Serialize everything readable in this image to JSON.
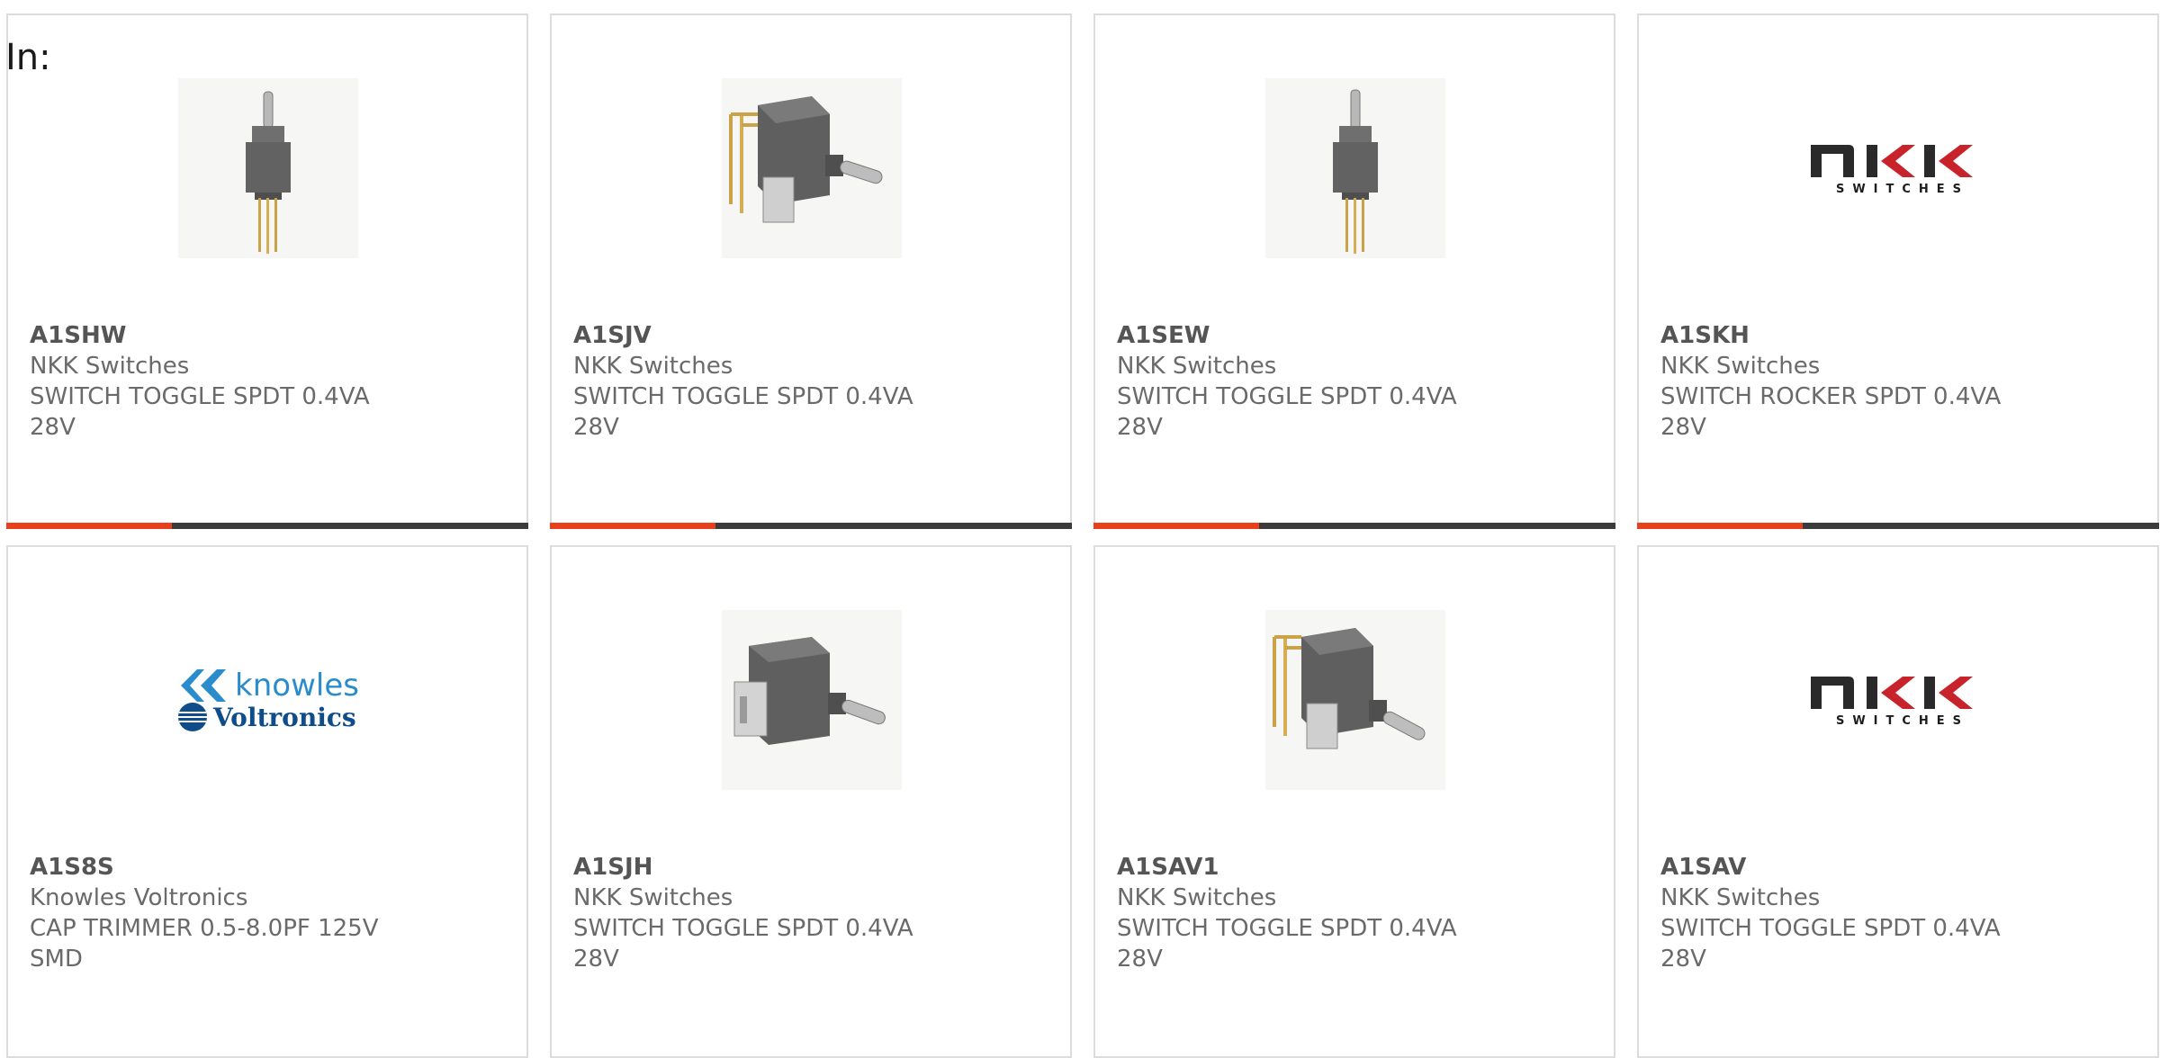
{
  "filter": {
    "in_label": "In:"
  },
  "colors": {
    "accent": "#e8401c",
    "bar_dark": "#3b3b3b",
    "text": "#6a6a6a",
    "border": "#dcdcdc"
  },
  "cards": [
    {
      "part": "A1SHW",
      "maker": "NKK Switches",
      "desc": "SWITCH TOGGLE SPDT 0.4VA",
      "desc2": "28V",
      "image": "toggle-switch-vertical-pins"
    },
    {
      "part": "A1SJV",
      "maker": "NKK Switches",
      "desc": "SWITCH TOGGLE SPDT 0.4VA",
      "desc2": "28V",
      "image": "toggle-switch-right-angle"
    },
    {
      "part": "A1SEW",
      "maker": "NKK Switches",
      "desc": "SWITCH TOGGLE SPDT 0.4VA",
      "desc2": "28V",
      "image": "toggle-switch-vertical-pins"
    },
    {
      "part": "A1SKH",
      "maker": "NKK Switches",
      "desc": "SWITCH ROCKER SPDT 0.4VA",
      "desc2": "28V",
      "image": "nkk-logo",
      "logo_main": "NKK",
      "logo_sub": "SWITCHES"
    },
    {
      "part": "A1S8S",
      "maker": "Knowles Voltronics",
      "desc": "CAP TRIMMER 0.5-8.0PF 125V",
      "desc2": "SMD",
      "image": "knowles-voltronics-logo",
      "logo_main": "knowles",
      "logo_sub": "Voltronics"
    },
    {
      "part": "A1SJH",
      "maker": "NKK Switches",
      "desc": "SWITCH TOGGLE SPDT 0.4VA",
      "desc2": "28V",
      "image": "toggle-switch-horizontal"
    },
    {
      "part": "A1SAV1",
      "maker": "NKK Switches",
      "desc": "SWITCH TOGGLE SPDT 0.4VA",
      "desc2": "28V",
      "image": "toggle-switch-right-angle"
    },
    {
      "part": "A1SAV",
      "maker": "NKK Switches",
      "desc": "SWITCH TOGGLE SPDT 0.4VA",
      "desc2": "28V",
      "image": "nkk-logo",
      "logo_main": "NKK",
      "logo_sub": "SWITCHES"
    }
  ]
}
